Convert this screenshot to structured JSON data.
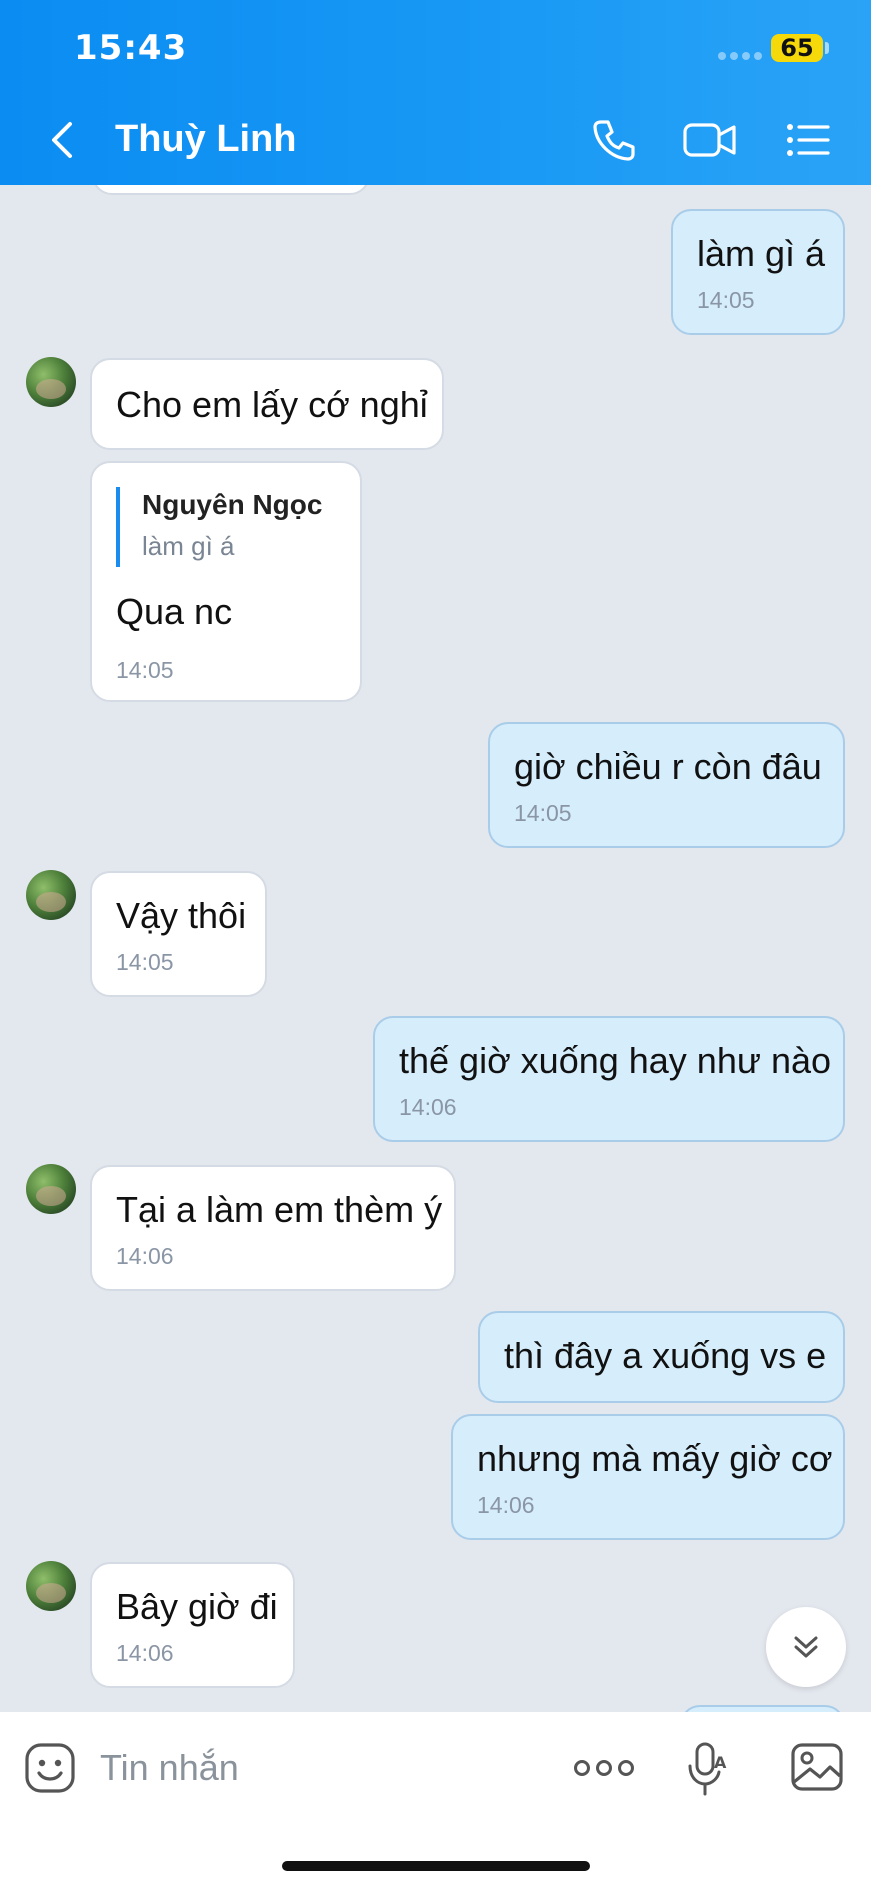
{
  "status_bar": {
    "time": "15:43",
    "battery": "65"
  },
  "header": {
    "contact_name": "Thuỳ Linh"
  },
  "messages": [
    {
      "side": "out",
      "text": "làm gì á",
      "time": "14:05"
    },
    {
      "side": "in",
      "text": "Cho em lấy cớ nghỉ"
    },
    {
      "side": "in",
      "quote_author": "Nguyên Ngọc",
      "quote_text": "làm gì á",
      "text": "Qua nc",
      "time": "14:05"
    },
    {
      "side": "out",
      "text": "giờ chiều r còn đâu",
      "time": "14:05"
    },
    {
      "side": "in",
      "text": "Vậy thôi",
      "time": "14:05"
    },
    {
      "side": "out",
      "text": "thế giờ xuống hay như nào",
      "time": "14:06"
    },
    {
      "side": "in",
      "text": "Tại a làm em thèm ý",
      "time": "14:06"
    },
    {
      "side": "out",
      "text": "thì đây a xuống vs e"
    },
    {
      "side": "out",
      "text": "nhưng mà mấy giờ cơ",
      "time": "14:06"
    },
    {
      "side": "in",
      "text": "Bây giờ đi",
      "time": "14:06"
    }
  ],
  "input": {
    "placeholder": "Tin nhắn"
  }
}
